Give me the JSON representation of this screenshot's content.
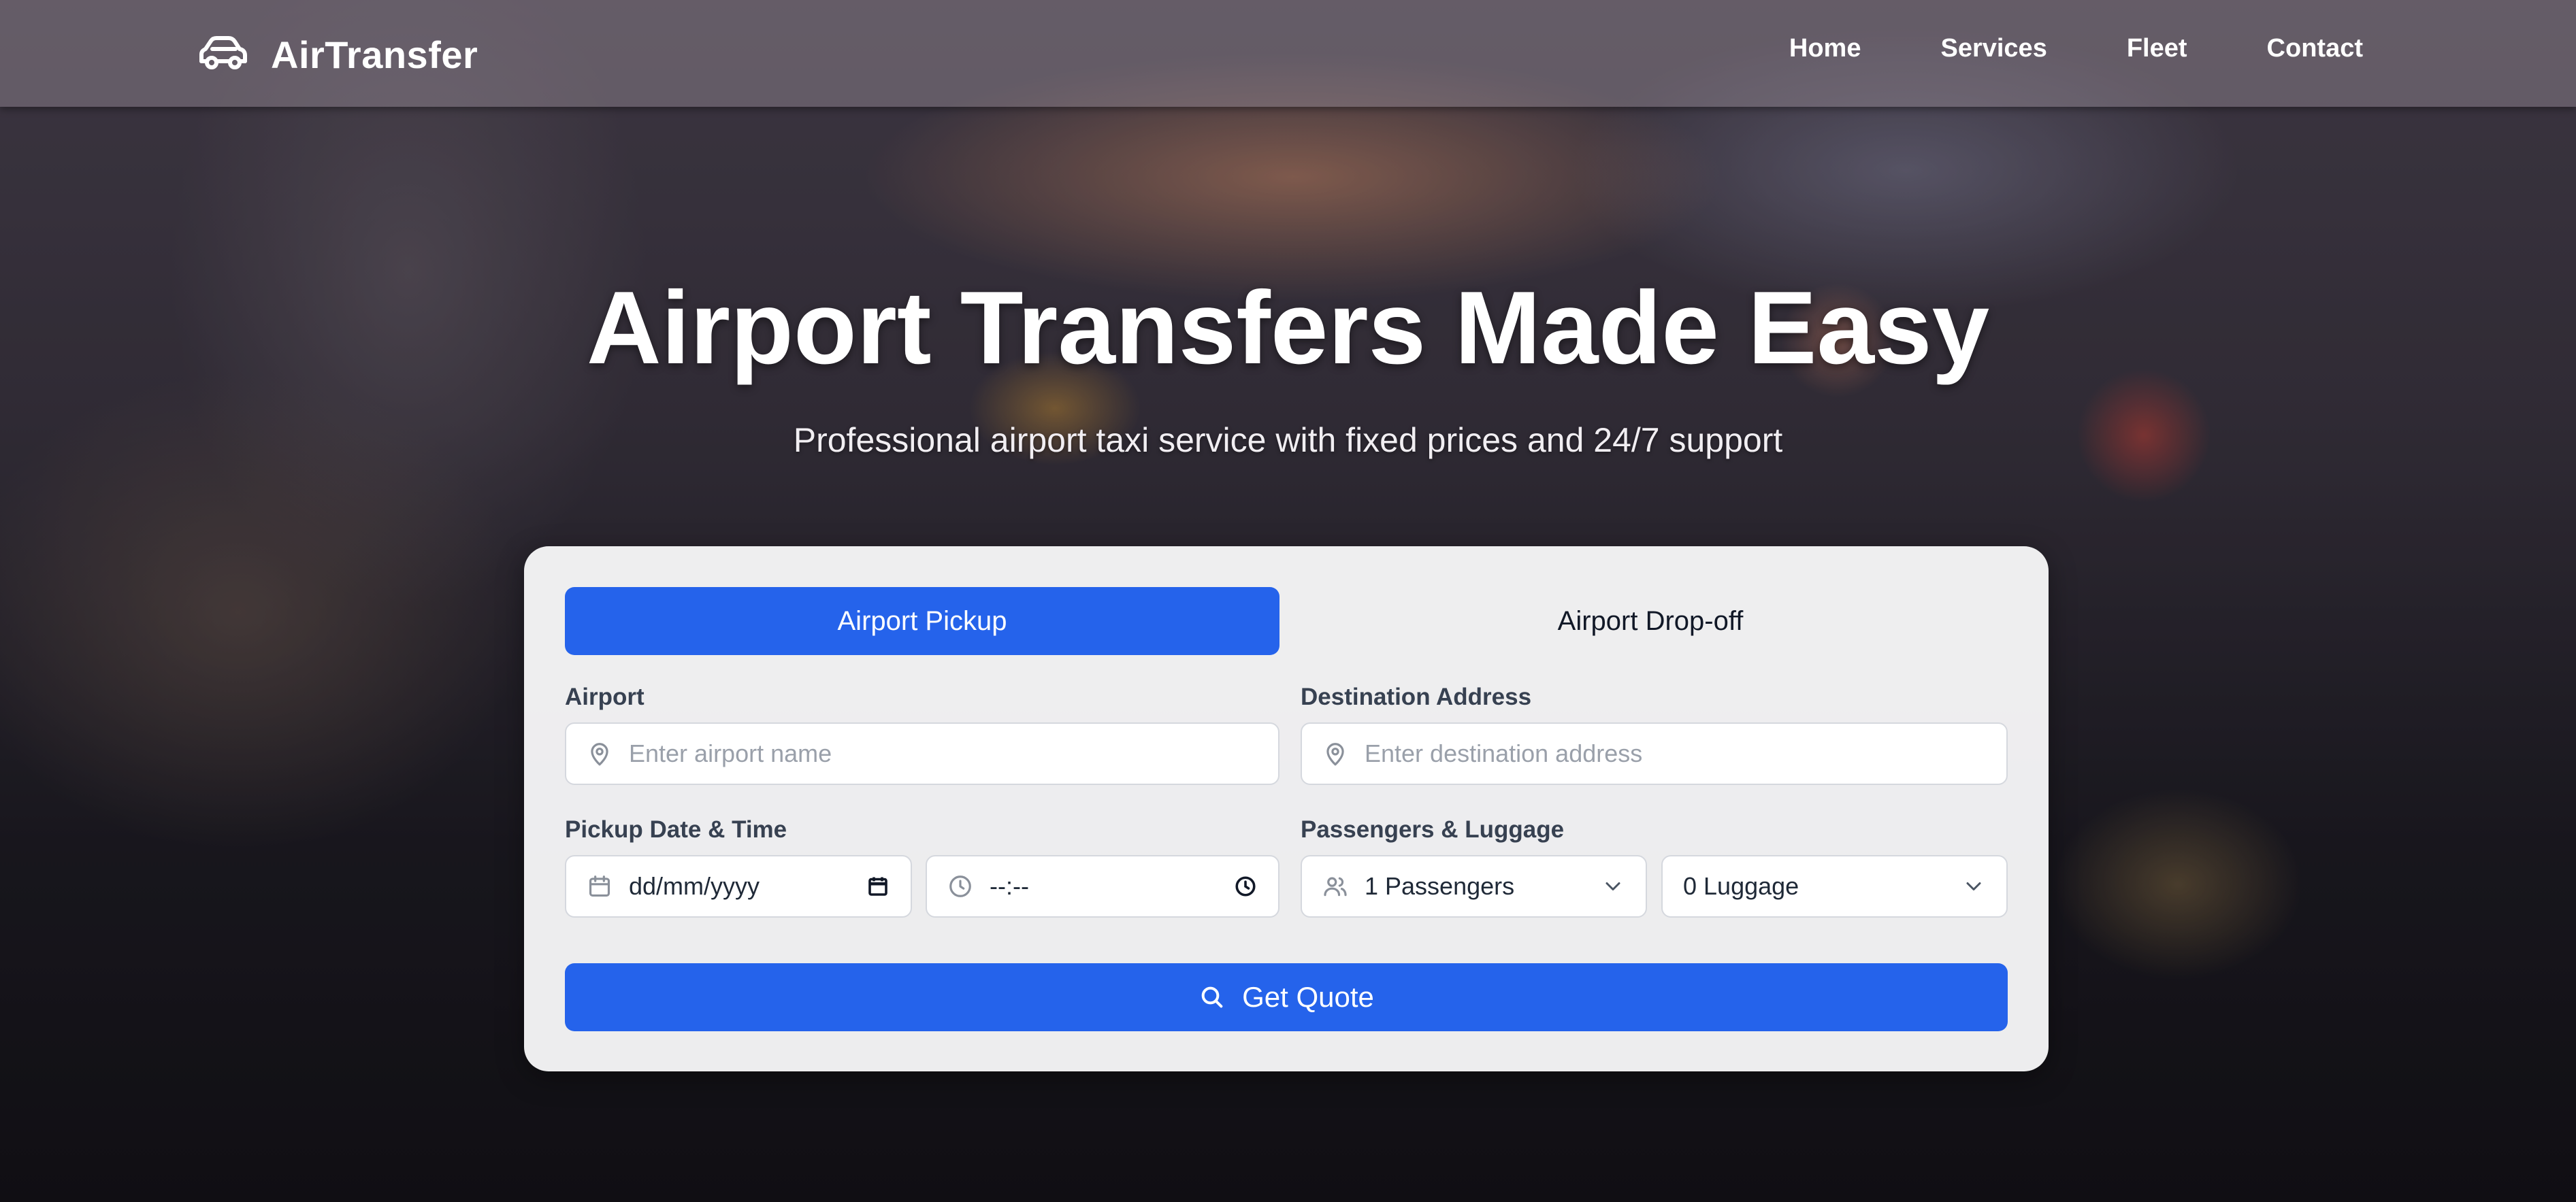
{
  "brand": {
    "name": "AirTransfer",
    "icon": "car-icon"
  },
  "nav": {
    "items": [
      "Home",
      "Services",
      "Fleet",
      "Contact"
    ]
  },
  "hero": {
    "title": "Airport Transfers Made Easy",
    "subtitle": "Professional airport taxi service with fixed prices and 24/7 support"
  },
  "booking": {
    "tabs": [
      {
        "label": "Airport Pickup",
        "active": true
      },
      {
        "label": "Airport Drop-off",
        "active": false
      }
    ],
    "airport": {
      "label": "Airport",
      "placeholder": "Enter airport name",
      "icon": "map-pin-icon"
    },
    "destination": {
      "label": "Destination Address",
      "placeholder": "Enter destination address",
      "icon": "map-pin-icon"
    },
    "pickup": {
      "label": "Pickup Date & Time",
      "date_placeholder": "dd/mm/yyyy",
      "time_placeholder": "--:--"
    },
    "passengers": {
      "label": "Passengers & Luggage",
      "passengers_value": "1 Passengers",
      "luggage_value": "0 Luggage"
    },
    "submit_label": "Get Quote"
  },
  "colors": {
    "accent": "#2563eb",
    "card_bg": "#f5f5f6"
  }
}
